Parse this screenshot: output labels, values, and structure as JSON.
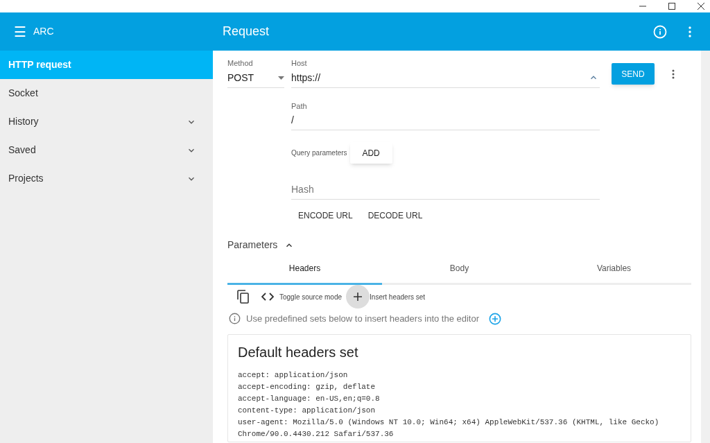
{
  "app_bar": {
    "menu_icon": "☰",
    "app_name": "ARC",
    "title": "Request"
  },
  "sidebar": {
    "items": [
      {
        "label": "HTTP request",
        "selected": true,
        "expandable": false
      },
      {
        "label": "Socket",
        "selected": false,
        "expandable": false
      },
      {
        "label": "History",
        "selected": false,
        "expandable": true
      },
      {
        "label": "Saved",
        "selected": false,
        "expandable": true
      },
      {
        "label": "Projects",
        "selected": false,
        "expandable": true
      }
    ]
  },
  "request": {
    "method": {
      "label": "Method",
      "value": "POST"
    },
    "host": {
      "label": "Host",
      "value": "https://"
    },
    "send_button": "SEND",
    "path": {
      "label": "Path",
      "value": "/"
    },
    "query_parameters": {
      "label": "Query parameters",
      "button": "ADD"
    },
    "hash": {
      "placeholder": "Hash"
    },
    "url_buttons": [
      "ENCODE URL",
      "DECODE URL"
    ]
  },
  "parameters": {
    "label": "Parameters",
    "expanded": true,
    "tabs": [
      {
        "label": "Headers",
        "selected": true
      },
      {
        "label": "Body",
        "selected": false
      },
      {
        "label": "Variables",
        "selected": false
      }
    ],
    "toolbar": {
      "toggle_source": "Toggle source mode",
      "insert_set": "Insert headers set"
    },
    "hint": "Use predefined sets below to insert headers into the editor",
    "headers_set": {
      "title": "Default headers set",
      "lines": [
        "accept: application/json",
        "accept-encoding: gzip, deflate",
        "accept-language: en-US,en;q=0.8",
        "content-type: application/json",
        "user-agent: Mozilla/5.0 (Windows NT 10.0; Win64; x64) AppleWebKit/537.36 (KHTML, like Gecko) Chrome/90.0.4430.212 Safari/537.36"
      ]
    }
  }
}
